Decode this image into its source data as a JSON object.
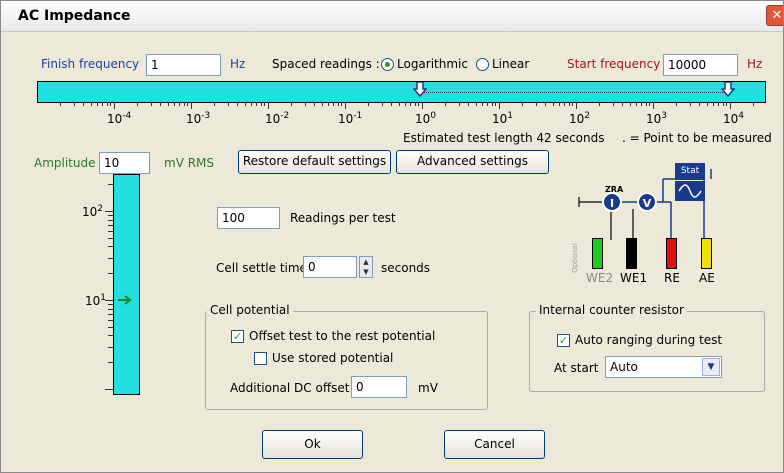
{
  "window": {
    "title": "AC Impedance",
    "close_glyph": "✕"
  },
  "finish_freq": {
    "label": "Finish frequency",
    "value": "1",
    "unit": "Hz"
  },
  "spacing": {
    "label": "Spaced readings :",
    "options": [
      "Logarithmic",
      "Linear"
    ],
    "selected": "Logarithmic"
  },
  "start_freq": {
    "label": "Start frequency",
    "value": "10000",
    "unit": "Hz"
  },
  "freq_scale": {
    "base": "10",
    "exponents": [
      "-4",
      "-3",
      "-2",
      "-1",
      "0",
      "1",
      "2",
      "3",
      "4"
    ],
    "estimate": "Estimated test length 42 seconds",
    "point_note": ". = Point to be measured"
  },
  "amplitude": {
    "label": "Amplitude",
    "value": "10",
    "unit": "mV RMS",
    "scale_base": "10",
    "scale_exponents": [
      "2",
      "1"
    ]
  },
  "buttons": {
    "restore": "Restore default settings",
    "advanced": "Advanced settings",
    "ok": "Ok",
    "cancel": "Cancel"
  },
  "readings": {
    "value": "100",
    "label": "Readings per test"
  },
  "settle": {
    "label": "Cell settle time",
    "value": "0",
    "unit": "seconds"
  },
  "cell_potential": {
    "title": "Cell potential",
    "offset_label": "Offset test to the rest potential",
    "offset_checked": true,
    "stored_label": "Use stored potential",
    "stored_checked": false,
    "dc_label": "Additional DC offset",
    "dc_value": "0",
    "dc_unit": "mV"
  },
  "counter": {
    "title": "Internal counter resistor",
    "auto_label": "Auto ranging during test",
    "auto_checked": true,
    "start_label": "At start",
    "start_value": "Auto"
  },
  "circuit": {
    "zra": "ZRA",
    "i_symbol": "I",
    "v_symbol": "V",
    "stat": "Stat",
    "optional": "Optional",
    "leads": [
      "WE2",
      "WE1",
      "RE",
      "AE"
    ],
    "lead_colors": [
      "#22cc22",
      "#000000",
      "#dd1111",
      "#f0e000"
    ]
  },
  "colors": {
    "cyan": "#22e0e0",
    "navy": "#1a3a8a"
  }
}
